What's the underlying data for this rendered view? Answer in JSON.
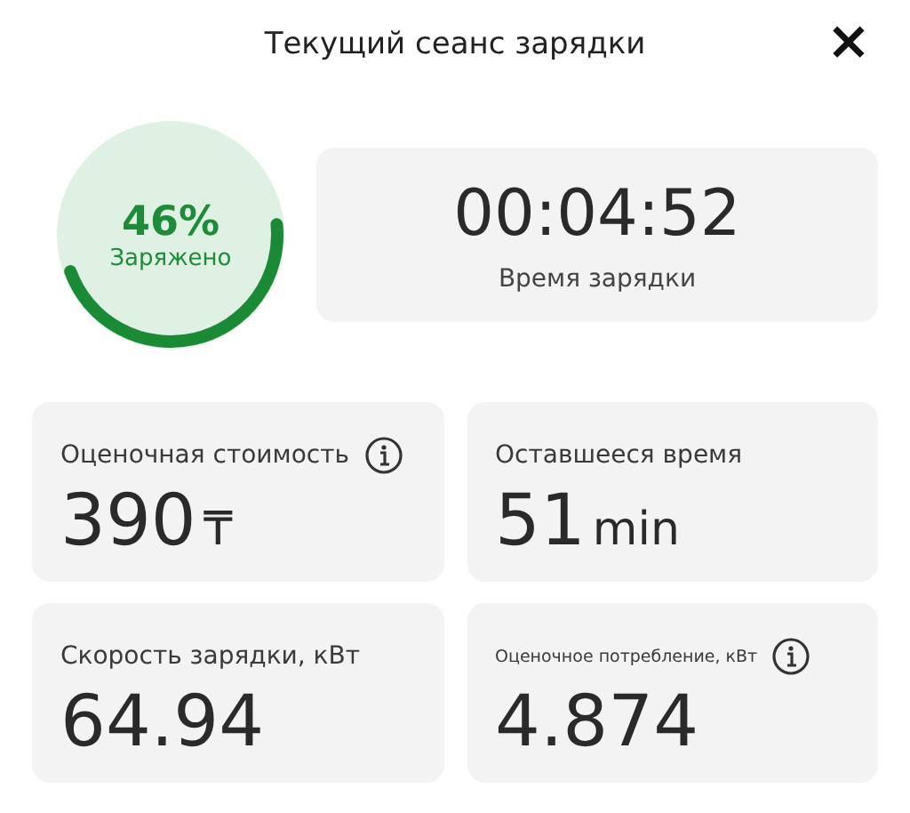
{
  "window": {
    "title": "Текущий сеанс зарядки",
    "close": "×"
  },
  "gauge": {
    "percent": "46%",
    "label": "Заряжено"
  },
  "timer": {
    "value": "00:04:52",
    "label": "Время зарядки"
  },
  "cards": [
    {
      "label": "Оценочная стоимость",
      "value": "390",
      "unit": "₸",
      "info": true,
      "small_label": false
    },
    {
      "label": "Оставшееся время",
      "value": "51",
      "unit": "min",
      "info": false,
      "small_label": false
    },
    {
      "label": "Скорость зарядки, кВт",
      "value": "64.94",
      "info": false,
      "small_label": false
    },
    {
      "label": "Оценочное потребление, кВт",
      "value": "4.874",
      "info": true,
      "small_label": true
    }
  ]
}
